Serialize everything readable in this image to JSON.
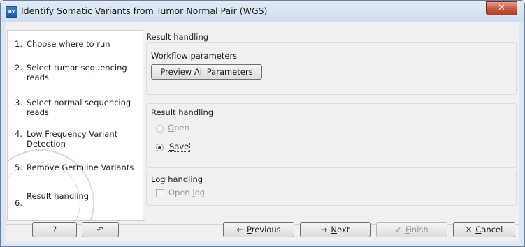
{
  "window": {
    "icon_text": "Bx",
    "title": "Identify Somatic Variants from Tumor Normal Pair (WGS)",
    "close_label": "✕"
  },
  "steps": [
    {
      "num": "1.",
      "label": "Choose where to run"
    },
    {
      "num": "2.",
      "label": "Select tumor sequencing reads"
    },
    {
      "num": "3.",
      "label": "Select normal sequencing reads"
    },
    {
      "num": "4.",
      "label": "Low Frequency Variant Detection"
    },
    {
      "num": "5.",
      "label": "Remove Germline Variants"
    },
    {
      "num": "6.",
      "label": "Result handling"
    }
  ],
  "panel": {
    "heading": "Result handling",
    "workflow_group_label": "Workflow parameters",
    "preview_button": "Preview All Parameters",
    "result_group_label": "Result handling",
    "open_option_mnemonic": "O",
    "open_option_rest": "pen",
    "save_option_mnemonic": "S",
    "save_option_rest": "ave",
    "log_group_label": "Log handling",
    "open_log_prefix": "Open ",
    "open_log_mnemonic": "l",
    "open_log_rest": "og"
  },
  "footer": {
    "help_label": "?",
    "reset_icon": "↶",
    "previous_mnemonic": "P",
    "previous_rest": "revious",
    "next_mnemonic": "N",
    "next_rest": "ext",
    "finish_mnemonic": "F",
    "finish_rest": "inish",
    "cancel_mnemonic": "C",
    "cancel_rest": "ancel"
  }
}
